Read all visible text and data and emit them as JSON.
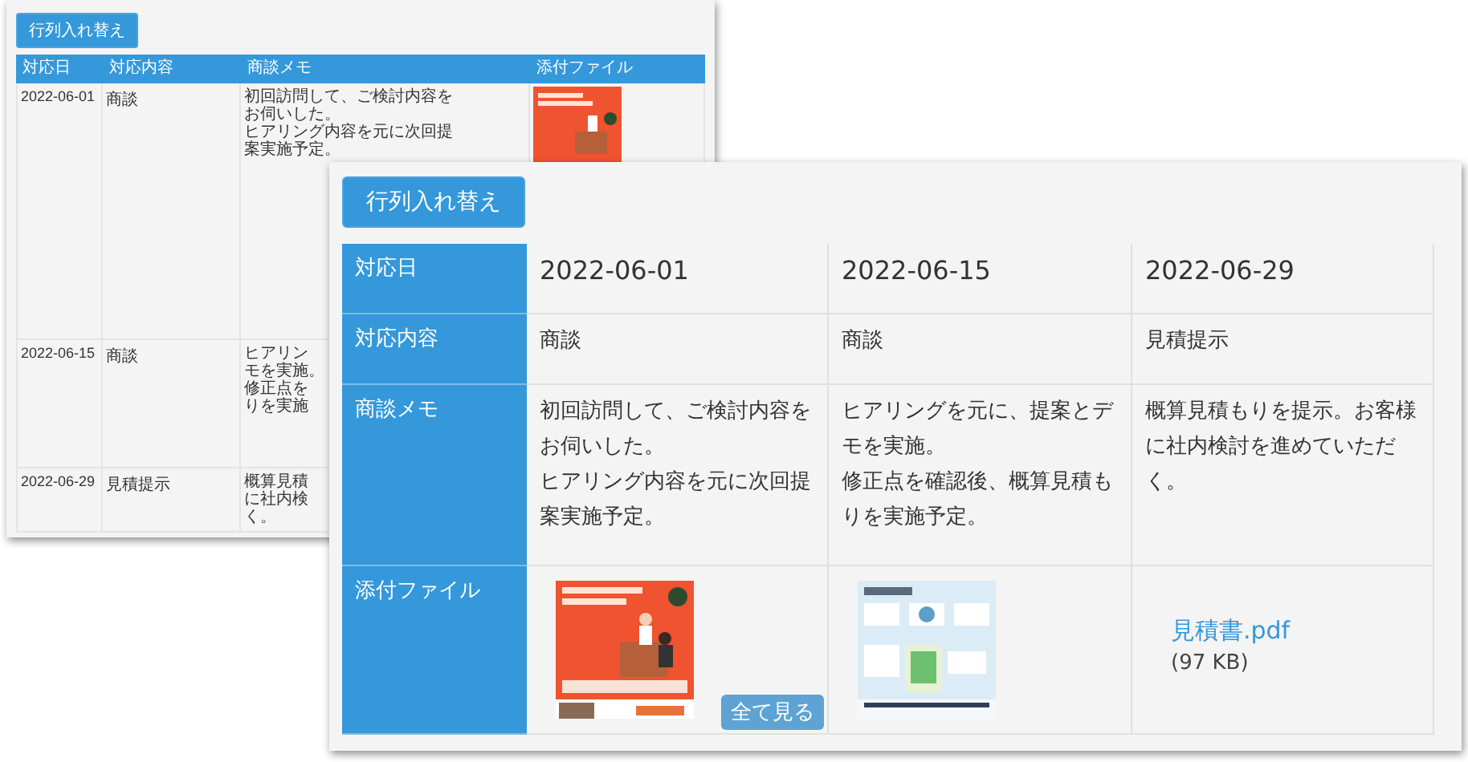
{
  "back_view": {
    "toggle_button": "行列入れ替え",
    "columns": [
      "対応日",
      "対応内容",
      "商談メモ",
      "添付ファイル"
    ],
    "rows": [
      {
        "date": "2022-06-01",
        "type": "商談",
        "memo": [
          "初回訪問して、ご検討内容を",
          "お伺いした。",
          "ヒアリング内容を元に次回提",
          "案実施予定。"
        ],
        "attachment": {
          "kind": "picture"
        }
      },
      {
        "date": "2022-06-15",
        "type": "商談",
        "memo": [
          "ヒアリン",
          "モを実施。",
          "修正点を",
          "りを実施"
        ]
      },
      {
        "date": "2022-06-29",
        "type": "見積提示",
        "memo": [
          "概算見積",
          "に社内検",
          "く。"
        ]
      }
    ]
  },
  "front_view": {
    "toggle_button": "行列入れ替え",
    "rows": [
      {
        "kind": "date",
        "label": "対応日",
        "cells": [
          {
            "text": [
              "2022-06-01"
            ]
          },
          {
            "text": [
              "2022-06-15"
            ]
          },
          {
            "text": [
              "2022-06-29"
            ]
          }
        ]
      },
      {
        "kind": "text",
        "label": "対応内容",
        "cells": [
          {
            "text": [
              "商談"
            ]
          },
          {
            "text": [
              "商談"
            ]
          },
          {
            "text": [
              "見積提示"
            ]
          }
        ]
      },
      {
        "kind": "text",
        "label": "商談メモ",
        "cells": [
          {
            "text": [
              "初回訪問して、ご検討内容を",
              "お伺いした。",
              "ヒアリング内容を元に次回提",
              "案実施予定。"
            ]
          },
          {
            "text": [
              "ヒアリングを元に、提案とデ",
              "モを実施。",
              "修正点を確認後、概算見積も",
              "りを実施予定。"
            ]
          },
          {
            "text": [
              "概算見積もりを提示。お客様",
              "に社内検討を進めていただ",
              "く。"
            ]
          }
        ]
      },
      {
        "kind": "attachments",
        "label": "添付ファイル",
        "cells": [
          {
            "kind": "picture",
            "view_all": "全て見る"
          },
          {
            "kind": "picture"
          },
          {
            "kind": "file",
            "name": "見積書.pdf",
            "size": "(97 KB)"
          }
        ]
      }
    ]
  }
}
